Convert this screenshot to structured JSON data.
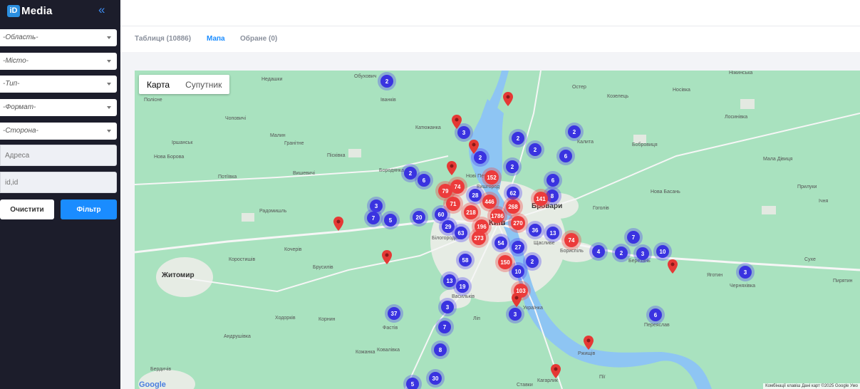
{
  "app": {
    "logo_mark": "iD",
    "logo_text": "Media",
    "collapse_icon": "«"
  },
  "filters": {
    "region": "-Область-",
    "city": "-Місто-",
    "type": "-Тип-",
    "format": "-Формат-",
    "side": "-Сторона-",
    "address_placeholder": "Адреса",
    "ids_placeholder": "id,id",
    "clear_label": "Очистити",
    "filter_label": "Фільтр"
  },
  "tabs": [
    {
      "label": "Таблиця (10886)"
    },
    {
      "label": "Мапа"
    },
    {
      "label": "Обране (0)"
    }
  ],
  "map": {
    "type_map": "Карта",
    "type_satellite": "Супутник",
    "google": "Google",
    "attribution": "Комбінації клавіш   Дані карт ©2025 Google   Умо",
    "labels": [
      "Недашки",
      "Обухович",
      "Іванків",
      "Полісне",
      "Чоповичі",
      "Малин",
      "Гранітне",
      "Катюжанка",
      "Пісківка",
      "Іршанськ",
      "Нова Борова",
      "Вишевичі",
      "Потіївка",
      "Радомишль",
      "Бородянка",
      "Нові Петрівці",
      "Вишгород",
      "Бровари",
      "Київ",
      "Білогородка",
      "Кочерів",
      "Коростишів",
      "Житомир",
      "Брусилів",
      "Корнин",
      "Фастів",
      "Андрушівка",
      "Ходорків",
      "Ковалівка",
      "Кожанка",
      "Бердичів",
      "Васильків",
      "Українка",
      "Бориспіль",
      "Щасливе",
      "Переяслав",
      "Ржищів",
      "Кагарлик",
      "Березань",
      "Яготин",
      "Черняхівка",
      "Остер",
      "Козелець",
      "Калита",
      "Бобровиця",
      "Гоголів",
      "Нова Басань",
      "Ніжинська",
      "Носівка",
      "Лосинівка",
      "Мала Дівиця",
      "Прилуки",
      "Ічня",
      "Пирятин",
      "Сухе",
      "Ставки",
      "Ліп",
      "Пії"
    ],
    "clusters_blue": [
      "2",
      "3",
      "2",
      "2",
      "6",
      "2",
      "2",
      "6",
      "2",
      "6",
      "2",
      "28",
      "62",
      "8",
      "20",
      "60",
      "3",
      "7",
      "5",
      "29",
      "63",
      "13",
      "36",
      "58",
      "54",
      "27",
      "2",
      "10",
      "4",
      "2",
      "3",
      "7",
      "10",
      "3",
      "13",
      "19",
      "3",
      "37",
      "3",
      "7",
      "8",
      "30",
      "5",
      "6"
    ],
    "clusters_red": [
      "74",
      "79",
      "152",
      "71",
      "446",
      "268",
      "141",
      "218",
      "1786",
      "270",
      "196",
      "273",
      "74",
      "150",
      "103"
    ]
  }
}
